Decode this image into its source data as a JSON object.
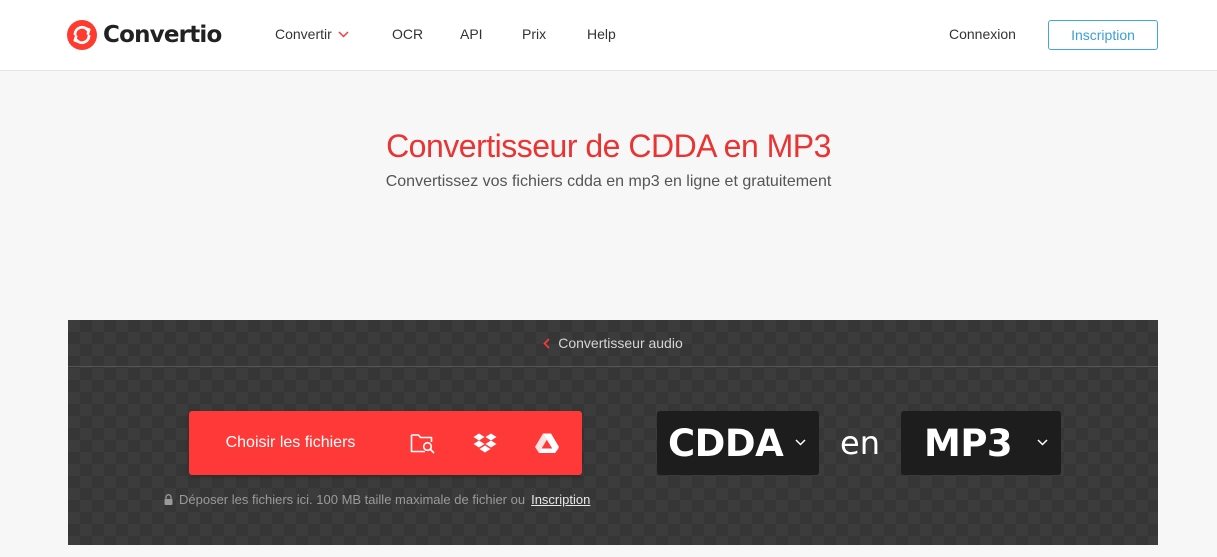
{
  "header": {
    "logo_text": "Convertio",
    "nav": [
      {
        "label": "Convertir",
        "has_dropdown": true
      },
      {
        "label": "OCR"
      },
      {
        "label": "API"
      },
      {
        "label": "Prix"
      },
      {
        "label": "Help"
      }
    ],
    "login_label": "Connexion",
    "signup_label": "Inscription"
  },
  "hero": {
    "title": "Convertisseur de CDDA en MP3",
    "subtitle": "Convertissez vos fichiers cdda en mp3 en ligne et gratuitement"
  },
  "converter": {
    "back_link": "Convertisseur audio",
    "choose_label": "Choisir les fichiers",
    "sources": [
      "folder-search-icon",
      "dropbox-icon",
      "google-drive-icon"
    ],
    "drop_note": "Déposer les fichiers ici. 100 MB taille maximale de fichier ou",
    "drop_note_link": "Inscription",
    "from_format": "CDDA",
    "connector": "en",
    "to_format": "MP3"
  },
  "colors": {
    "brand_red": "#ff3838",
    "title_red": "#ea3333",
    "signup_blue": "#3aa0d4",
    "panel_bg": "#3c3c3c",
    "format_box_bg": "#1d1d1d"
  }
}
